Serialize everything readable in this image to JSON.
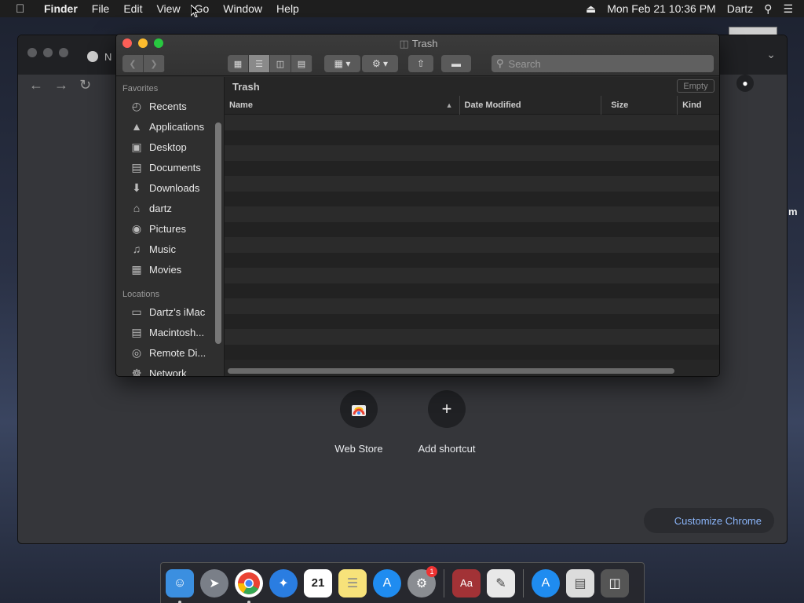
{
  "menubar": {
    "app": "Finder",
    "items": [
      "File",
      "Edit",
      "View",
      "Go",
      "Window",
      "Help"
    ],
    "datetime": "Mon Feb 21  10:36 PM",
    "user": "Dartz"
  },
  "desktop": {
    "edge_fragment": "m"
  },
  "chrome": {
    "tab_title": "N",
    "shortcuts": [
      {
        "label": "Web Store"
      },
      {
        "label": "Add shortcut"
      }
    ],
    "customize_label": "Customize Chrome"
  },
  "finder": {
    "title": "Trash",
    "search_placeholder": "Search",
    "sidebar": {
      "favorites_heading": "Favorites",
      "favorites": [
        {
          "label": "Recents",
          "icon": "clock-icon"
        },
        {
          "label": "Applications",
          "icon": "applications-icon"
        },
        {
          "label": "Desktop",
          "icon": "desktop-icon"
        },
        {
          "label": "Documents",
          "icon": "documents-icon"
        },
        {
          "label": "Downloads",
          "icon": "downloads-icon"
        },
        {
          "label": "dartz",
          "icon": "home-icon"
        },
        {
          "label": "Pictures",
          "icon": "camera-icon"
        },
        {
          "label": "Music",
          "icon": "music-icon"
        },
        {
          "label": "Movies",
          "icon": "film-icon"
        }
      ],
      "locations_heading": "Locations",
      "locations": [
        {
          "label": "Dartz’s iMac",
          "icon": "computer-icon"
        },
        {
          "label": "Macintosh...",
          "icon": "disk-icon"
        },
        {
          "label": "Remote Di...",
          "icon": "disc-icon"
        },
        {
          "label": "Network",
          "icon": "network-icon"
        }
      ]
    },
    "pathbar": "Trash",
    "empty_button": "Empty",
    "columns": [
      "Name",
      "Date Modified",
      "Size",
      "Kind"
    ]
  },
  "dock": {
    "apps": [
      {
        "name": "Finder",
        "icon": "finder-icon",
        "color": "#3b8fe0"
      },
      {
        "name": "Launchpad",
        "icon": "launchpad-icon",
        "color": "#7a7f88"
      },
      {
        "name": "Chrome",
        "icon": "chrome-icon",
        "color": "#ffffff"
      },
      {
        "name": "Safari",
        "icon": "safari-icon",
        "color": "#2a7de1"
      },
      {
        "name": "Calendar",
        "icon": "calendar-icon",
        "color": "#ffffff",
        "text": "21"
      },
      {
        "name": "Notes",
        "icon": "notes-icon",
        "color": "#f7e27a"
      },
      {
        "name": "App Store",
        "icon": "appstore-icon",
        "color": "#1f8cf0"
      },
      {
        "name": "System Preferences",
        "icon": "gear-icon",
        "color": "#8a8d92",
        "badge": "1"
      },
      {
        "name": "Dictionary",
        "icon": "dictionary-icon",
        "color": "#a23236",
        "text": "Aa"
      },
      {
        "name": "TextEdit",
        "icon": "textedit-icon",
        "color": "#e8e8e8"
      },
      {
        "name": "App Store",
        "icon": "appstore-icon",
        "color": "#1f8cf0"
      },
      {
        "name": "Document",
        "icon": "document-icon",
        "color": "#dcdcdc"
      },
      {
        "name": "Trash",
        "icon": "trash-icon",
        "color": "#555555"
      }
    ]
  }
}
